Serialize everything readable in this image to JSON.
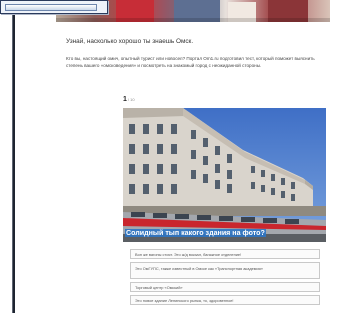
{
  "page": {
    "heading": "Узнай, насколько хорошо ты знаешь Омск.",
    "intro": "Кто вы, настоящий омич, опытный турист или новосел? Портал Om1.ru подготовил тест, который поможет выяснить степень вашего «омсковедения» и посмотреть на знакомый город с неожиданной стороны."
  },
  "quiz": {
    "question_number": "1",
    "question_total": "/ 10",
    "photo_caption": "Солидный тып какого здания на фото?",
    "answers": [
      "Вон же вагоны стоят. Это ж/д вокзал, багажное отделение!",
      "Это ОмГУПС, также известный в Омске как «Транспортная академия»",
      "Торговый центр «Омский»",
      "Это новое здание Ленинского рынка, то, здоровенное!"
    ]
  },
  "colors": {
    "accent_caption_bg": "#2e75c4",
    "left_rule": "#1e2430"
  }
}
